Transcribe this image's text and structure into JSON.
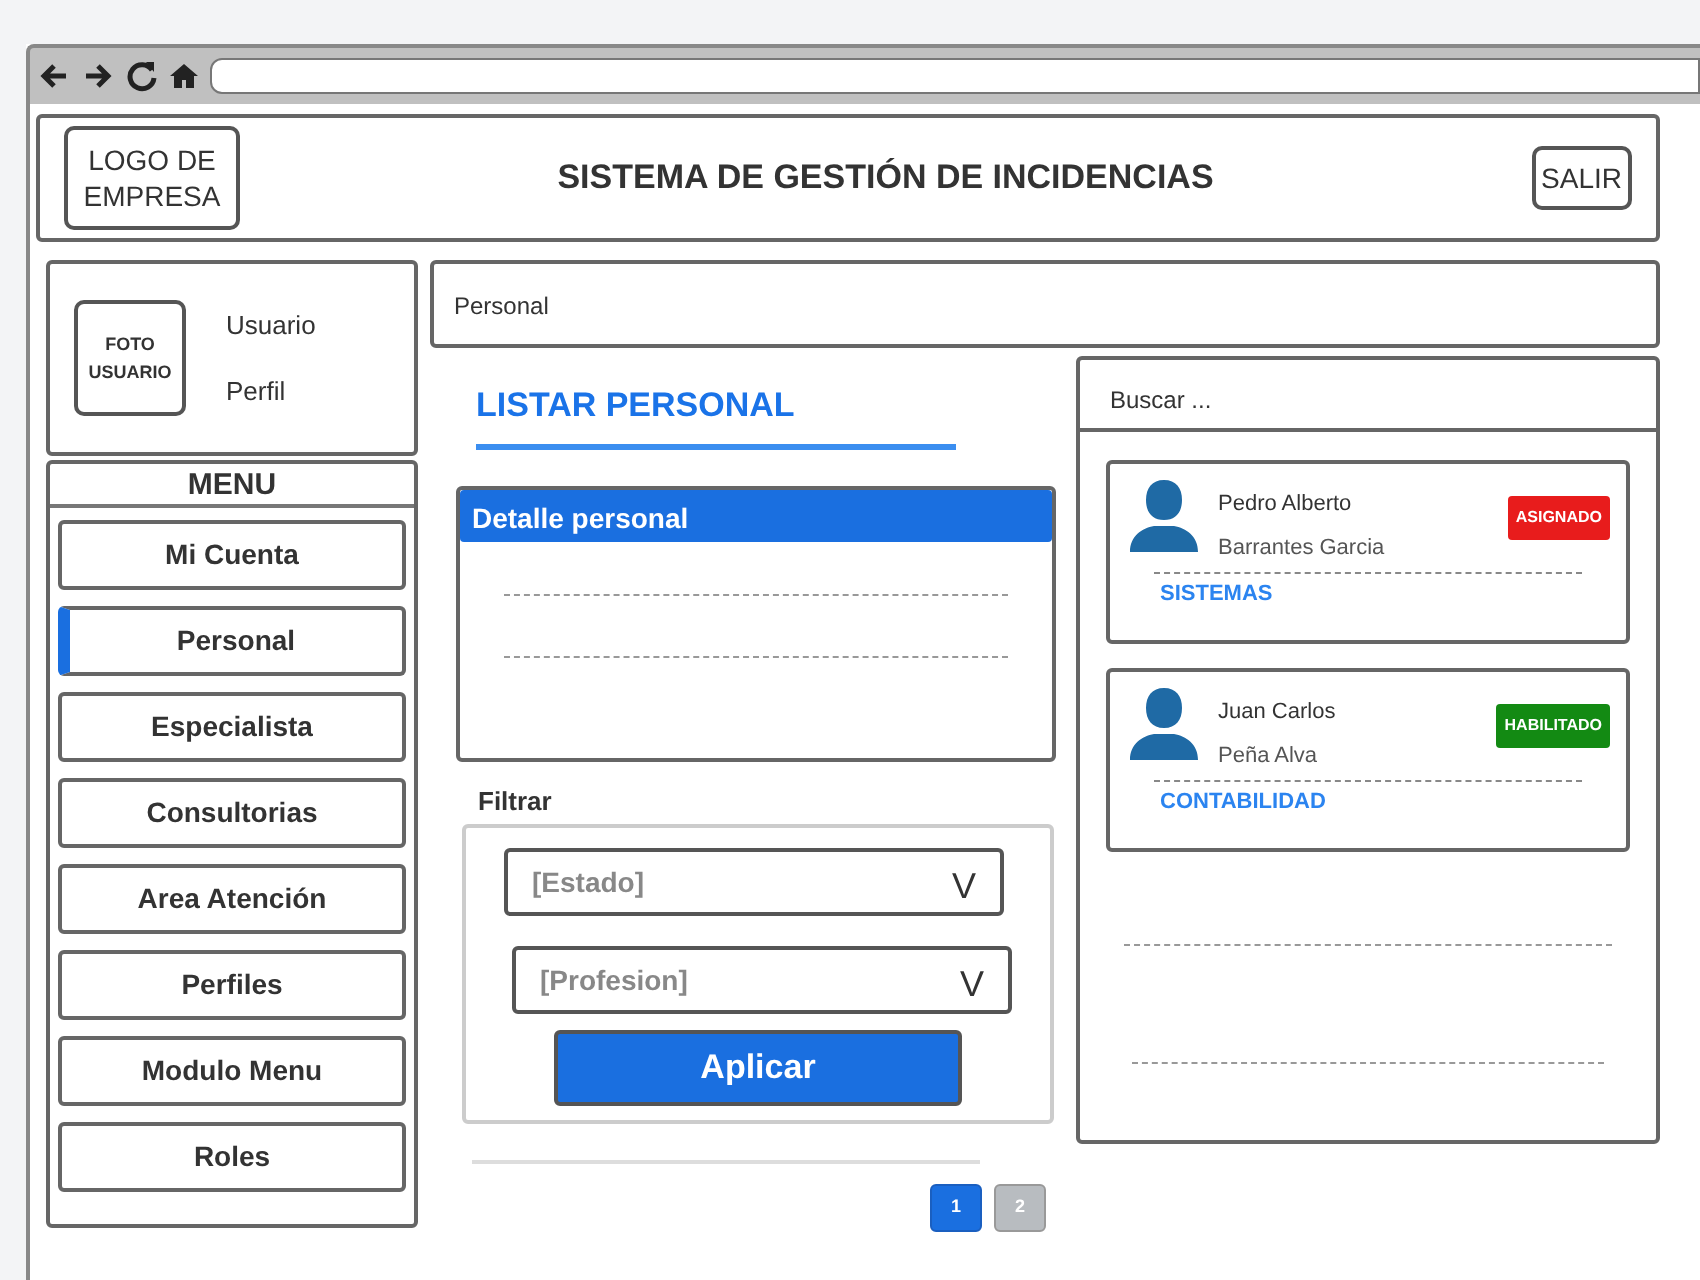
{
  "header": {
    "logo": "LOGO DE EMPRESA",
    "title": "SISTEMA DE GESTIÓN DE INCIDENCIAS",
    "logout": "SALIR"
  },
  "user": {
    "photo": "FOTO USUARIO",
    "name": "Usuario",
    "profile": "Perfil"
  },
  "menu": {
    "title": "MENU",
    "items": [
      {
        "label": "Mi Cuenta",
        "selected": false
      },
      {
        "label": "Personal",
        "selected": true
      },
      {
        "label": "Especialista",
        "selected": false
      },
      {
        "label": "Consultorias",
        "selected": false
      },
      {
        "label": "Area Atención",
        "selected": false
      },
      {
        "label": "Perfiles",
        "selected": false
      },
      {
        "label": "Modulo Menu",
        "selected": false
      },
      {
        "label": "Roles",
        "selected": false
      }
    ]
  },
  "breadcrumb": "Personal",
  "section_title": "LISTAR PERSONAL",
  "detail_panel": {
    "title": "Detalle personal"
  },
  "filter": {
    "label": "Filtrar",
    "selects": [
      {
        "placeholder": "[Estado]",
        "caret": "V"
      },
      {
        "placeholder": "[Profesion]",
        "caret": "V"
      }
    ],
    "apply": "Aplicar"
  },
  "pagination": [
    {
      "label": "1",
      "selected": true
    },
    {
      "label": "2",
      "selected": false
    }
  ],
  "search": {
    "placeholder": "Buscar ..."
  },
  "people": [
    {
      "first_name": "Pedro Alberto",
      "last_name": "Barrantes Garcia",
      "status": "ASIGNADO",
      "color": "#e81c1c",
      "area": "SISTEMAS"
    },
    {
      "first_name": "Juan Carlos",
      "last_name": "Peña Alva",
      "status": "HABILITADO",
      "color": "#138a13",
      "area": "CONTABILIDAD"
    }
  ]
}
